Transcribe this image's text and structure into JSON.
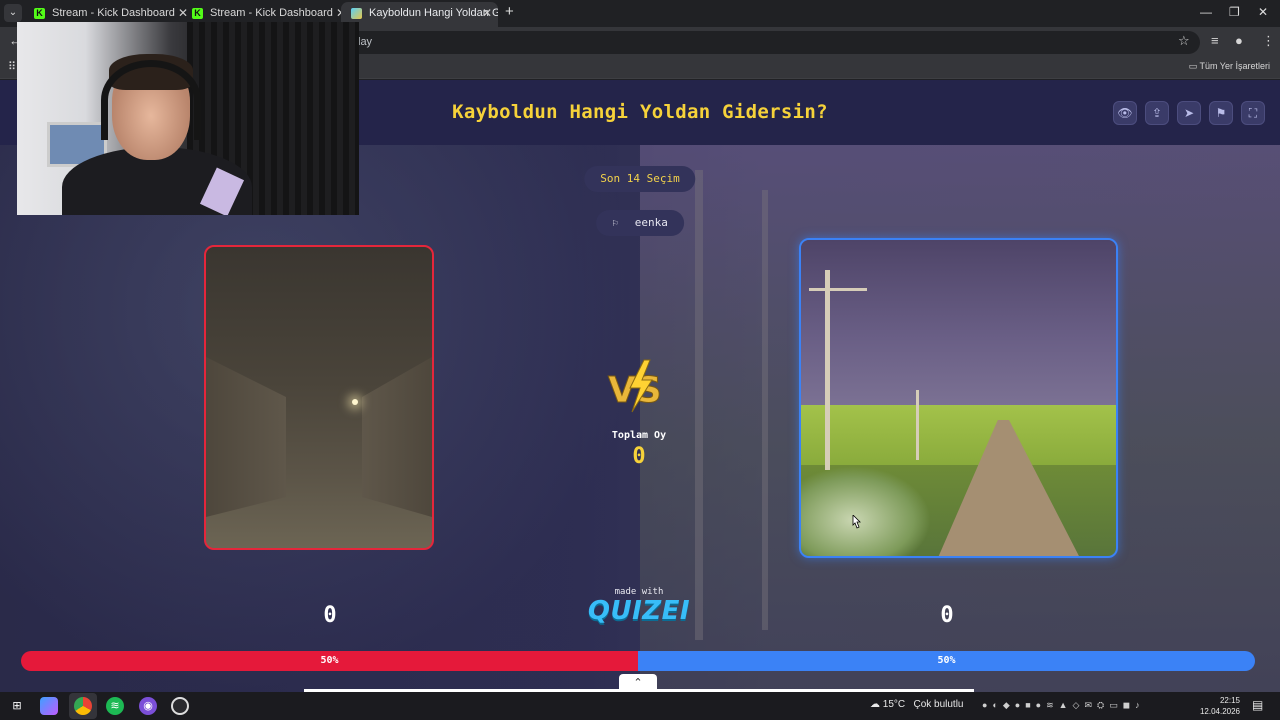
{
  "browser": {
    "tabs": [
      {
        "title": "Stream - Kick Dashboard",
        "favicon": "K"
      },
      {
        "title": "Stream - Kick Dashboard",
        "favicon": "K"
      },
      {
        "title": "Kayboldun Hangi Yoldan Gidersin?",
        "favicon": ""
      }
    ],
    "url_fragment": "lay",
    "bookmarks_all_label": "Tüm Yer İşaretleri"
  },
  "quiz": {
    "title": "Kayboldun Hangi Yoldan Gidersin?",
    "recent_label": "Son 14 Seçim",
    "voter_name": "eenka",
    "total_label": "Toplam Oy",
    "total_value": "0",
    "left": {
      "score": "0",
      "percent": "50%",
      "color": "#e5193a"
    },
    "right": {
      "score": "0",
      "percent": "50%",
      "color": "#3b82f6"
    },
    "made_with_label": "made with",
    "brand_name": "QUIZEI",
    "accent_color": "#f6d23a"
  },
  "taskbar": {
    "temperature": "15°C",
    "weather": "Çok bulutlu",
    "time": "22:15",
    "date": "12.04.2026"
  }
}
